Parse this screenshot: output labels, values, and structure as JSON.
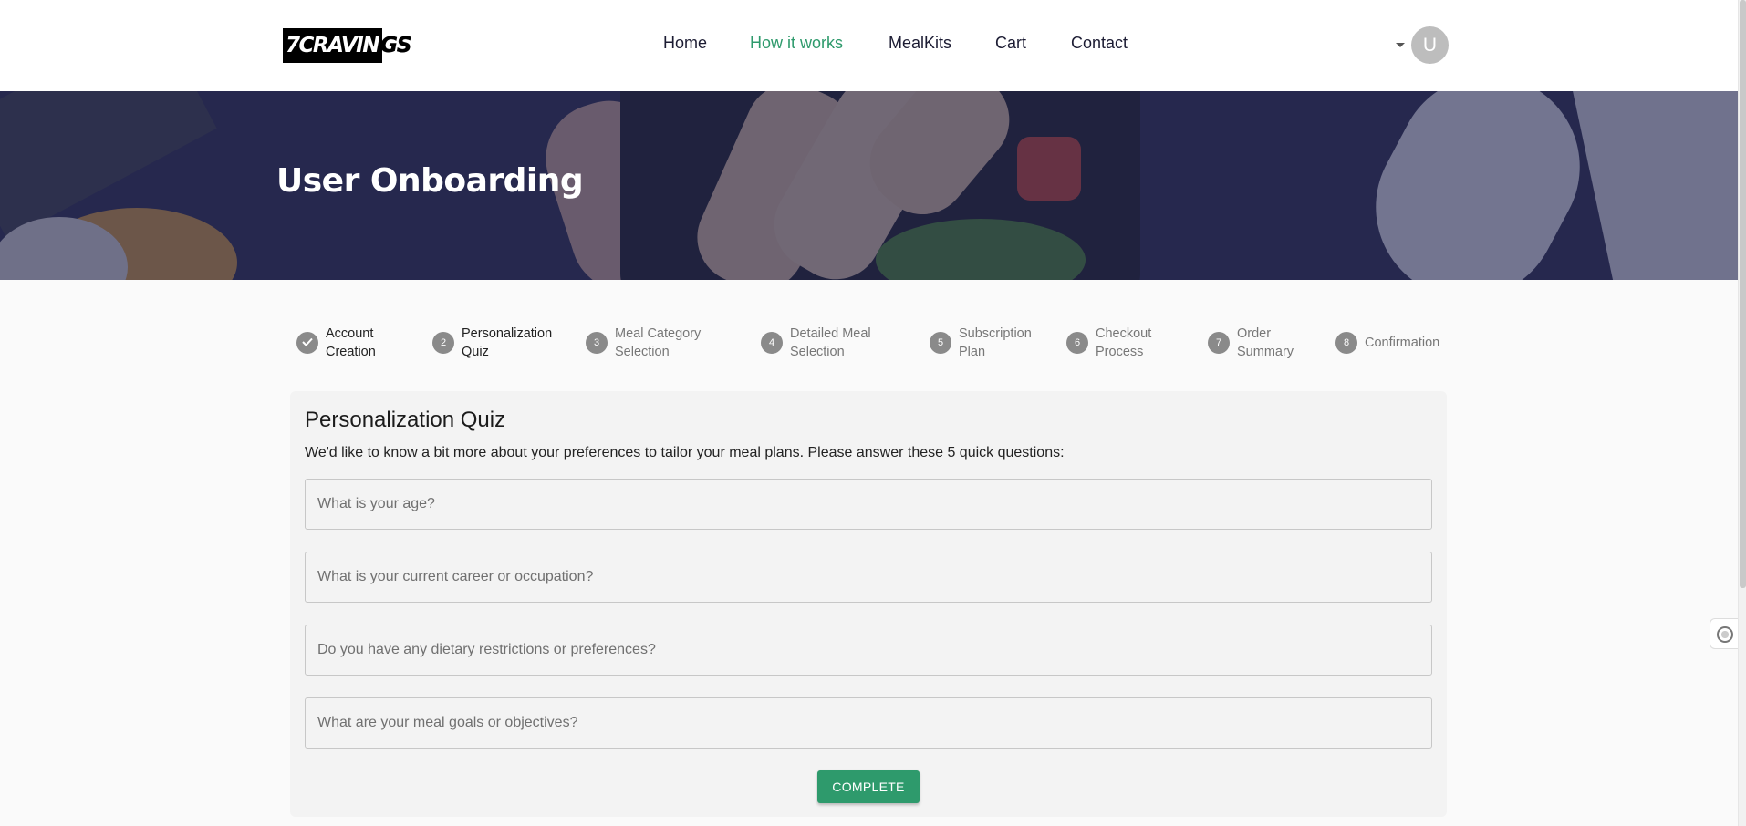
{
  "brand": {
    "logo_text": "7CRAVIN",
    "logo_tail": "GS"
  },
  "nav": {
    "items": [
      {
        "label": "Home"
      },
      {
        "label": "How it works"
      },
      {
        "label": "MealKits"
      },
      {
        "label": "Cart"
      },
      {
        "label": "Contact"
      }
    ],
    "active": "How it works",
    "avatar_initial": "U"
  },
  "hero": {
    "title": "User Onboarding"
  },
  "steps": [
    {
      "number": "",
      "label": "Account\nCreation",
      "state": "done"
    },
    {
      "number": "2",
      "label": "Personalization\nQuiz",
      "state": "active"
    },
    {
      "number": "3",
      "label": "Meal Category\nSelection",
      "state": "pending"
    },
    {
      "number": "4",
      "label": "Detailed Meal\nSelection",
      "state": "pending"
    },
    {
      "number": "5",
      "label": "Subscription\nPlan",
      "state": "pending"
    },
    {
      "number": "6",
      "label": "Checkout\nProcess",
      "state": "pending"
    },
    {
      "number": "7",
      "label": "Order\nSummary",
      "state": "pending"
    },
    {
      "number": "8",
      "label": "Confirmation",
      "state": "pending"
    }
  ],
  "quiz": {
    "title": "Personalization Quiz",
    "intro": "We'd like to know a bit more about your preferences to tailor your meal plans. Please answer these 5 quick questions:",
    "questions": [
      {
        "placeholder": "What is your age?",
        "value": ""
      },
      {
        "placeholder": "What is your current career or occupation?",
        "value": ""
      },
      {
        "placeholder": "Do you have any dietary restrictions or preferences?",
        "value": ""
      },
      {
        "placeholder": "What are your meal goals or objectives?",
        "value": ""
      }
    ],
    "submit_label": "COMPLETE"
  },
  "colors": {
    "accent": "#2e9a6c",
    "nav_text": "#1c1c33",
    "hero_overlay": "#242652",
    "step_badge": "#8a8a8a"
  },
  "icons": {
    "done_step": "check-icon",
    "side_widget": "widget-icon",
    "account_menu": "caret-down-icon"
  }
}
